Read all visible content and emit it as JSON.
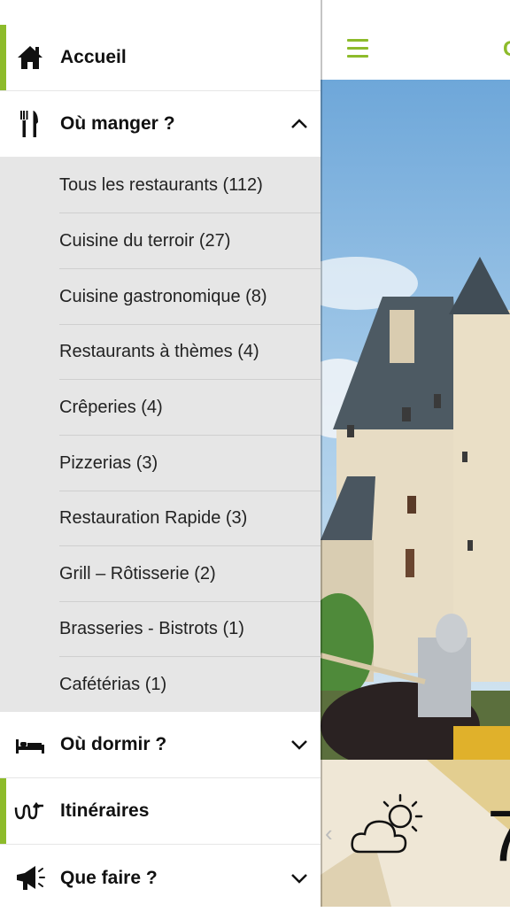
{
  "background_app": {
    "title_partial": "C",
    "weather": {
      "temperature_partial": "7"
    }
  },
  "drawer": {
    "home": {
      "label": "Accueil"
    },
    "eat": {
      "label": "Où manger ?",
      "sub_items": [
        {
          "label": "Tous les restaurants (112)"
        },
        {
          "label": "Cuisine du terroir (27)"
        },
        {
          "label": "Cuisine gastronomique (8)"
        },
        {
          "label": "Restaurants à thèmes (4)"
        },
        {
          "label": "Crêperies (4)"
        },
        {
          "label": "Pizzerias (3)"
        },
        {
          "label": "Restauration Rapide (3)"
        },
        {
          "label": "Grill – Rôtisserie (2)"
        },
        {
          "label": "Brasseries - Bistrots (1)"
        },
        {
          "label": "Cafétérias (1)"
        }
      ]
    },
    "sleep": {
      "label": "Où dormir ?"
    },
    "routes": {
      "label": "Itinéraires"
    },
    "todo": {
      "label": "Que faire ?"
    }
  },
  "colors": {
    "accent": "#8dbb2b",
    "submenu_bg": "#e6e6e6"
  }
}
